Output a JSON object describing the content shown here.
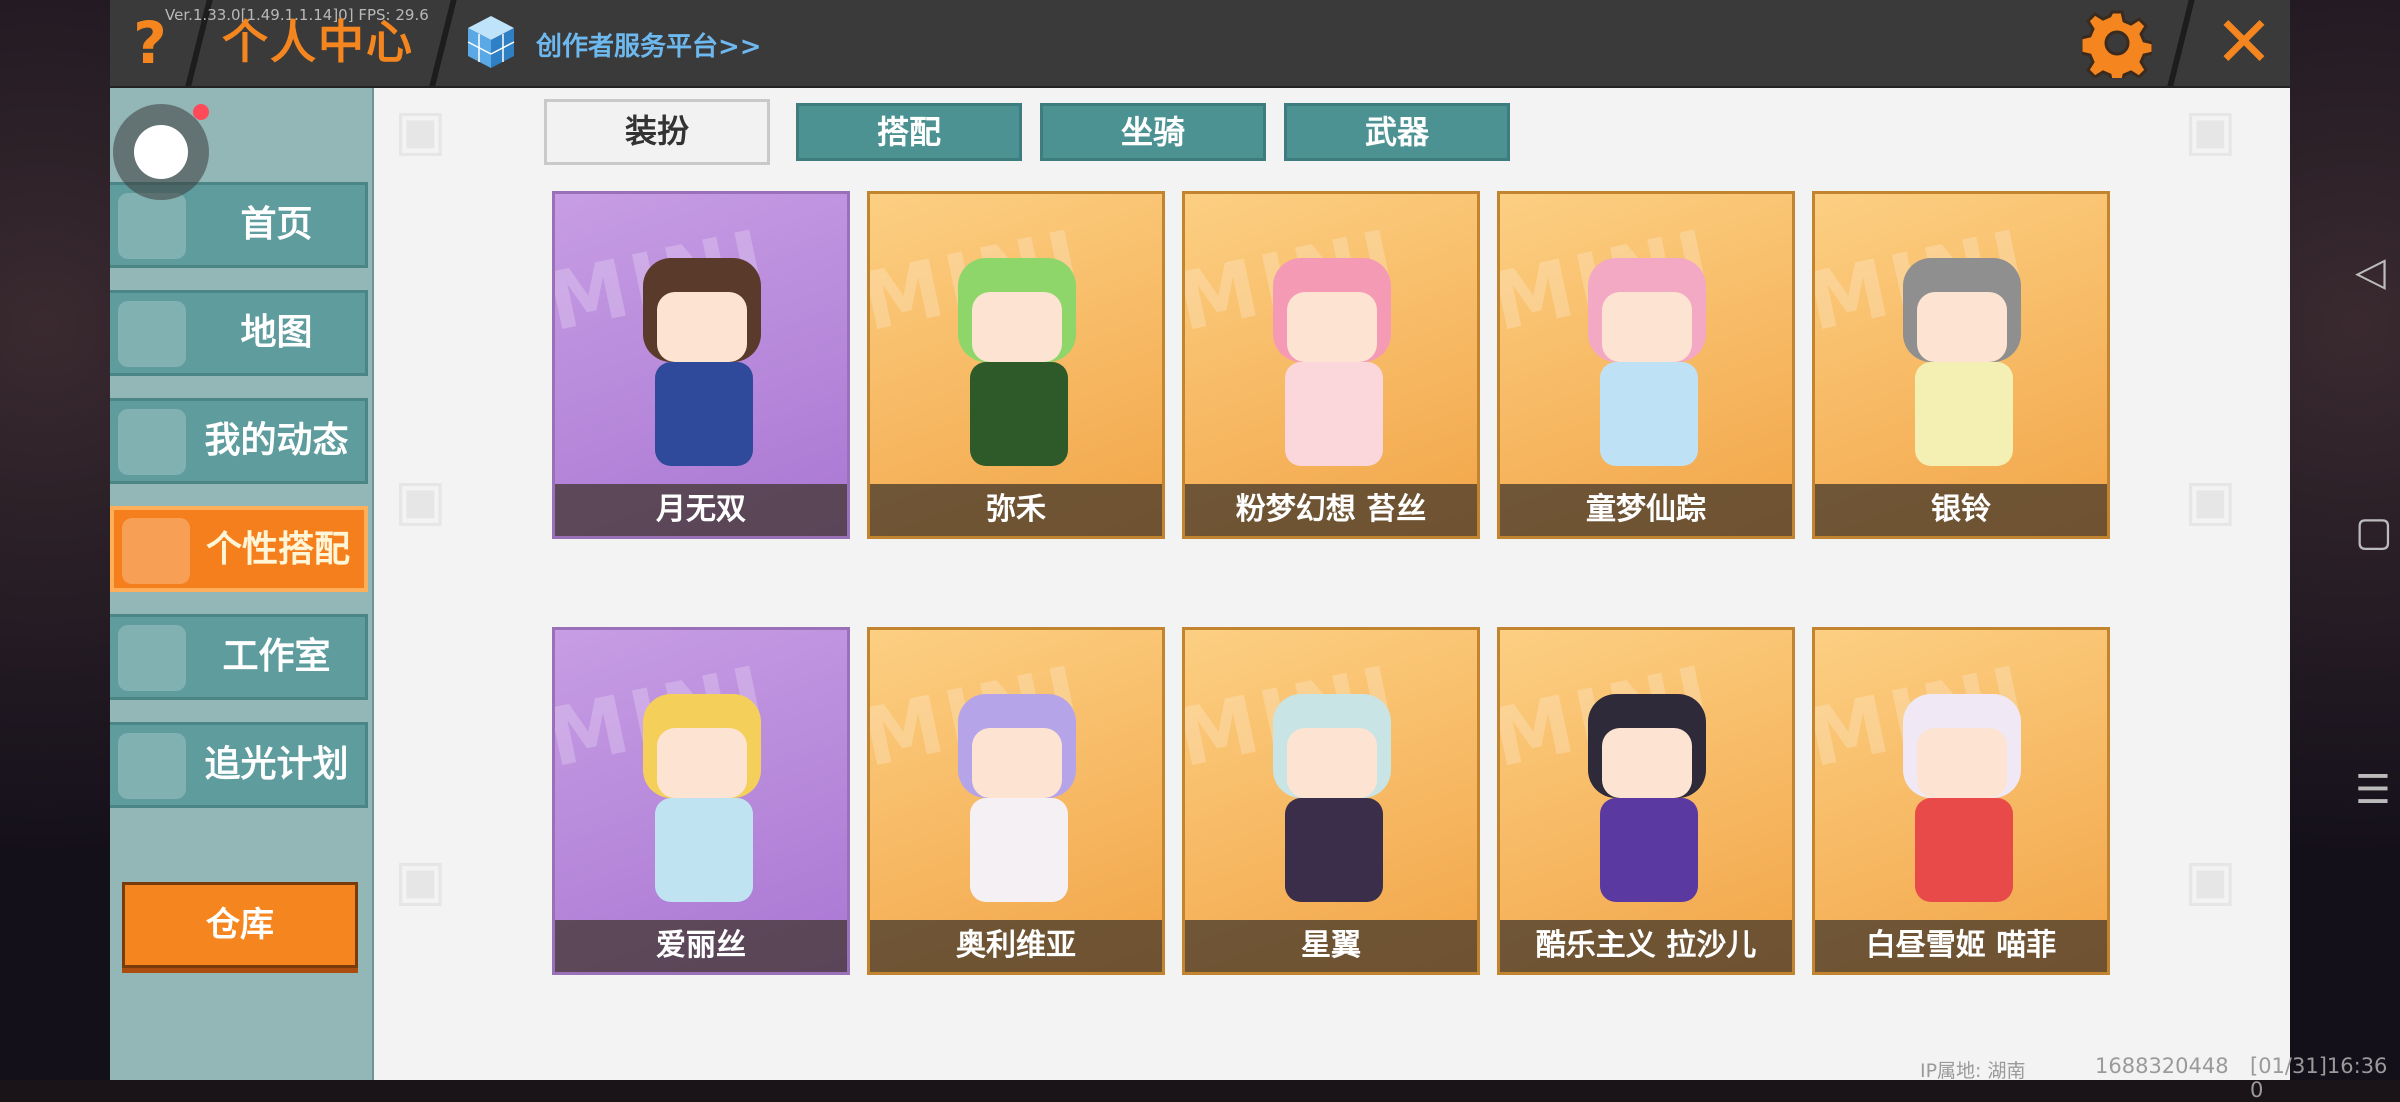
{
  "header": {
    "help_label": "?",
    "title": "个人中心",
    "version_text": "Ver.1.33.0[1.49.1.1.14]0] FPS: 29.6",
    "creator_link": "创作者服务平台>>",
    "close_label": "✕"
  },
  "sidebar": {
    "items": [
      {
        "label": "首页",
        "icon": "shirt-icon"
      },
      {
        "label": "地图",
        "icon": "picture-icon"
      },
      {
        "label": "我的动态",
        "icon": "bell-icon"
      },
      {
        "label": "个性搭配",
        "icon": "character-icon",
        "active": true
      },
      {
        "label": "工作室",
        "icon": "tree-icon"
      },
      {
        "label": "追光计划",
        "icon": "badge-icon"
      }
    ],
    "storage_label": "仓库"
  },
  "tabs": [
    {
      "label": "装扮",
      "active": true
    },
    {
      "label": "搭配"
    },
    {
      "label": "坐骑"
    },
    {
      "label": "武器"
    }
  ],
  "cards": [
    {
      "name": "月无双",
      "theme": "purple"
    },
    {
      "name": "弥禾",
      "theme": "orange"
    },
    {
      "name": "粉梦幻想 苔丝",
      "theme": "orange"
    },
    {
      "name": "童梦仙踪",
      "theme": "orange"
    },
    {
      "name": "银铃",
      "theme": "orange"
    },
    {
      "name": "爱丽丝",
      "theme": "purple"
    },
    {
      "name": "奥利维亚",
      "theme": "orange"
    },
    {
      "name": "星翼",
      "theme": "orange"
    },
    {
      "name": "酷乐主义 拉沙儿",
      "theme": "orange"
    },
    {
      "name": "白昼雪姬 喵菲",
      "theme": "orange"
    }
  ],
  "card_watermark": "MINI",
  "footer": {
    "ip_location": "IP属地: 湖南",
    "user_id": "1688320448",
    "timestamp": "[01/31]16:36 0"
  },
  "colors": {
    "accent_orange": "#f5861f",
    "sidebar_teal": "#5f9c9d",
    "tab_teal": "#4c9293",
    "link_blue": "#6db8ee"
  }
}
